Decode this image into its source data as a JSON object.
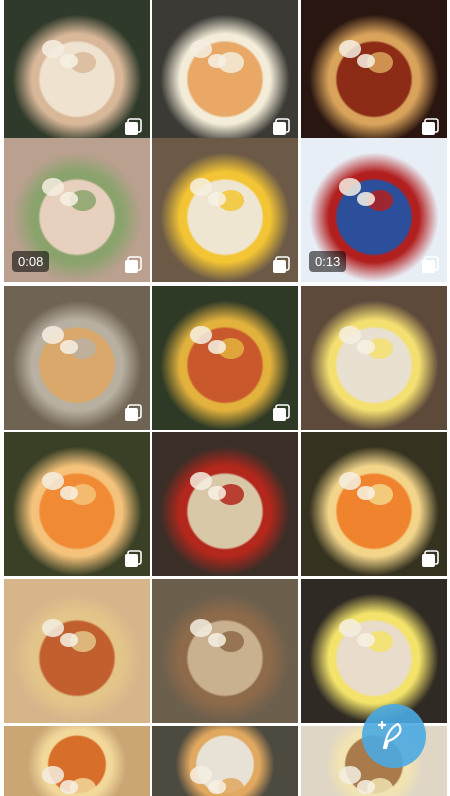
{
  "grid": {
    "tiles": [
      {
        "kind": "post",
        "multi": true,
        "palette": [
          "#2f3a2a",
          "#efe2cf",
          "#d9b89a"
        ]
      },
      {
        "kind": "post",
        "multi": true,
        "palette": [
          "#3b3a35",
          "#e9a866",
          "#f3ecd8"
        ]
      },
      {
        "kind": "post",
        "multi": true,
        "palette": [
          "#2a1610",
          "#8c2c17",
          "#d9a35b"
        ]
      },
      {
        "kind": "video",
        "duration": "0:08",
        "multi": true,
        "palette": [
          "#b9a08f",
          "#e7d0bd",
          "#8aa36c"
        ]
      },
      {
        "kind": "post",
        "multi": true,
        "palette": [
          "#6c5a47",
          "#efe6d2",
          "#f3c534"
        ]
      },
      {
        "kind": "video",
        "duration": "0:13",
        "multi": true,
        "palette": [
          "#e8eef6",
          "#2c4f9b",
          "#b21f1f"
        ]
      },
      {
        "kind": "post",
        "multi": true,
        "palette": [
          "#6f6353",
          "#d9a86a",
          "#b8b1a2"
        ]
      },
      {
        "kind": "post",
        "multi": true,
        "palette": [
          "#2f3a26",
          "#c9592c",
          "#e3b23d"
        ]
      },
      {
        "kind": "post",
        "multi": false,
        "palette": [
          "#5e4a3b",
          "#e8e1d2",
          "#f4df71"
        ]
      },
      {
        "kind": "post",
        "multi": true,
        "palette": [
          "#3a4026",
          "#f08a34",
          "#f4c27a"
        ]
      },
      {
        "kind": "post",
        "multi": false,
        "palette": [
          "#3b2e27",
          "#d9c8a7",
          "#b3271c"
        ]
      },
      {
        "kind": "post",
        "multi": true,
        "palette": [
          "#35321f",
          "#f0842e",
          "#f3d58a"
        ]
      },
      {
        "kind": "post",
        "multi": false,
        "palette": [
          "#d6b58a",
          "#c25f2e",
          "#e3c58a"
        ]
      },
      {
        "kind": "post",
        "multi": false,
        "palette": [
          "#6c5f4c",
          "#c9b08e",
          "#8d6a4a"
        ]
      },
      {
        "kind": "post",
        "multi": false,
        "palette": [
          "#2f2a24",
          "#e9dccb",
          "#f3e36a"
        ]
      },
      {
        "kind": "post",
        "multi": false,
        "palette": [
          "#caa675",
          "#d76e2a",
          "#f2d89b"
        ]
      },
      {
        "kind": "post",
        "multi": false,
        "palette": [
          "#4d4a40",
          "#e8e1d6",
          "#e1a860"
        ]
      },
      {
        "kind": "post",
        "multi": false,
        "palette": [
          "#dfd6c6",
          "#a87a4c",
          "#f1e3b2"
        ]
      }
    ]
  },
  "fab": {
    "icon": "new-post-feather-icon",
    "color": "#4aaae2"
  }
}
